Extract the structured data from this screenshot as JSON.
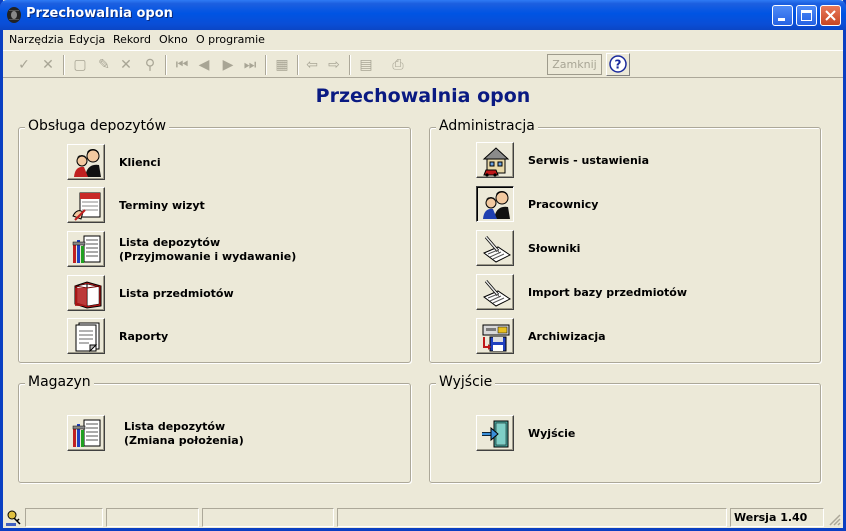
{
  "window": {
    "title": "Przechowalnia opon"
  },
  "menu": [
    "Narzędzia",
    "Edycja",
    "Rekord",
    "Okno",
    "O programie"
  ],
  "toolbar": {
    "close_label": "Zamknij"
  },
  "main_title": "Przechowalnia opon",
  "groups": {
    "obsluga": {
      "title": "Obsługa depozytów",
      "items": [
        {
          "label": "Klienci",
          "icon": "clients-icon"
        },
        {
          "label": "Terminy wizyt",
          "icon": "calendar-icon"
        },
        {
          "label": "Lista depozytów",
          "label2": "(Przyjmowanie i wydawanie)",
          "icon": "deposit-list-icon"
        },
        {
          "label": "Lista przedmiotów",
          "icon": "book-icon"
        },
        {
          "label": "Raporty",
          "icon": "reports-icon"
        }
      ]
    },
    "administracja": {
      "title": "Administracja",
      "items": [
        {
          "label": "Serwis - ustawienia",
          "icon": "house-car-icon"
        },
        {
          "label": "Pracownicy",
          "icon": "employees-icon"
        },
        {
          "label": "Słowniki",
          "icon": "dictionary-icon"
        },
        {
          "label": "Import bazy przedmiotów",
          "icon": "import-icon"
        },
        {
          "label": "Archiwizacja",
          "icon": "archive-icon"
        }
      ]
    },
    "magazyn": {
      "title": "Magazyn",
      "items": [
        {
          "label": "Lista depozytów",
          "label2": "(Zmiana położenia)",
          "icon": "deposit-list-icon"
        }
      ]
    },
    "wyjscie": {
      "title": "Wyjście",
      "items": [
        {
          "label": "Wyjście",
          "icon": "exit-door-icon"
        }
      ]
    }
  },
  "status": {
    "version": "Wersja 1.40"
  }
}
